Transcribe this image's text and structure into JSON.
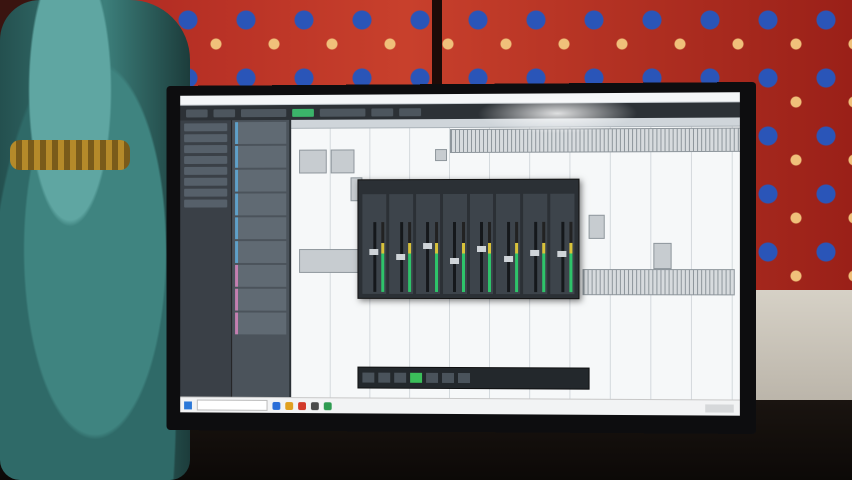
{
  "scene": {
    "description_type": "photo of a monitor showing a DAW",
    "colors": {
      "curtain": "#b02a22",
      "curtain_flower": "#2a55b8",
      "statue": "#3c7f7b",
      "screen_bg": "#e9edf0",
      "daw_dark": "#2c3136",
      "meter_green": "#2ec46a",
      "play_green": "#3bbf5a"
    }
  },
  "daw": {
    "tracks": [
      {
        "color": "#5fa0c8"
      },
      {
        "color": "#5fa0c8"
      },
      {
        "color": "#5fa0c8"
      },
      {
        "color": "#5fa0c8"
      },
      {
        "color": "#5fa0c8"
      },
      {
        "color": "#5fa0c8"
      },
      {
        "color": "#c47fb0"
      },
      {
        "color": "#c47fb0"
      },
      {
        "color": "#c47fb0"
      }
    ],
    "mixer_channels": [
      {
        "level": 0.62
      },
      {
        "level": 0.55
      },
      {
        "level": 0.7
      },
      {
        "level": 0.48
      },
      {
        "level": 0.66
      },
      {
        "level": 0.52
      },
      {
        "level": 0.6
      },
      {
        "level": 0.58
      }
    ]
  }
}
